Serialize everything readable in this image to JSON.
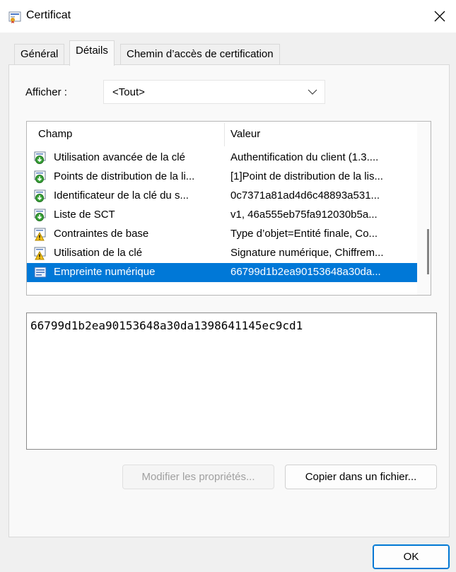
{
  "window": {
    "title": "Certificat"
  },
  "tabs": [
    {
      "label": "Général"
    },
    {
      "label": "Détails"
    },
    {
      "label": "Chemin d’accès de certification"
    }
  ],
  "filter": {
    "label": "Afficher :",
    "selected": "<Tout>"
  },
  "list": {
    "columns": [
      "Champ",
      "Valeur"
    ],
    "rows": [
      {
        "field": "Utilisation avancée de la clé",
        "value": "Authentification du client (1.3....",
        "icon": "extension-icon"
      },
      {
        "field": "Points de distribution de la li...",
        "value": "[1]Point de distribution de la lis...",
        "icon": "extension-icon"
      },
      {
        "field": "Identificateur de la clé du s...",
        "value": "0c7371a81ad4d6c48893a531...",
        "icon": "extension-icon"
      },
      {
        "field": "Liste de SCT",
        "value": "v1, 46a555eb75fa912030b5a...",
        "icon": "extension-icon"
      },
      {
        "field": "Contraintes de base",
        "value": "Type d’objet=Entité finale, Co...",
        "icon": "critical-extension-icon"
      },
      {
        "field": "Utilisation de la clé",
        "value": "Signature numérique, Chiffrem...",
        "icon": "critical-extension-icon"
      },
      {
        "field": "Empreinte numérique",
        "value": "66799d1b2ea90153648a30da...",
        "icon": "property-icon",
        "selected": true
      }
    ]
  },
  "detail": {
    "value": "66799d1b2ea90153648a30da1398641145ec9cd1"
  },
  "buttons": {
    "edit_properties": "Modifier les propriétés...",
    "copy_to_file": "Copier dans un fichier...",
    "ok": "OK"
  },
  "colors": {
    "selection": "#0078d7",
    "focus": "#0078d4"
  }
}
